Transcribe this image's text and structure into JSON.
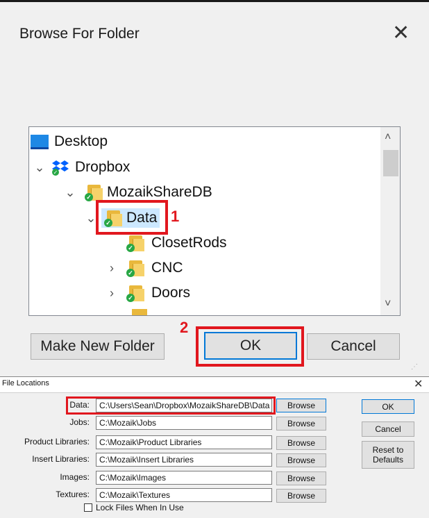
{
  "browse_dialog": {
    "title": "Browse For Folder",
    "close_glyph": "✕",
    "tree": [
      {
        "label": "Desktop",
        "icon": "desktop-icon",
        "chevron": ""
      },
      {
        "label": "Dropbox",
        "icon": "dropbox-icon",
        "chevron": "⌄"
      },
      {
        "label": "MozaikShareDB",
        "icon": "folder-icon",
        "chevron": "⌄"
      },
      {
        "label": "Data",
        "icon": "folder-icon",
        "chevron": "⌄",
        "selected": true
      },
      {
        "label": "ClosetRods",
        "icon": "folder-icon",
        "chevron": ""
      },
      {
        "label": "CNC",
        "icon": "folder-icon",
        "chevron": "›"
      },
      {
        "label": "Doors",
        "icon": "folder-icon",
        "chevron": "›"
      }
    ],
    "buttons": {
      "make_new_folder": "Make New Folder",
      "ok": "OK",
      "cancel": "Cancel"
    },
    "annotations": {
      "step1": "1",
      "step2": "2"
    },
    "colors": {
      "annotation_red": "#e1171e",
      "focus_blue": "#0078d7",
      "selection": "#cce8ff"
    }
  },
  "file_locations": {
    "title": "File Locations",
    "close_glyph": "✕",
    "rows": [
      {
        "label": "Data:",
        "value": "C:\\Users\\Sean\\Dropbox\\MozaikShareDB\\Data",
        "browse": "Browse"
      },
      {
        "label": "Jobs:",
        "value": "C:\\Mozaik\\Jobs",
        "browse": "Browse"
      },
      {
        "label": "Product Libraries:",
        "value": "C:\\Mozaik\\Product Libraries",
        "browse": "Browse"
      },
      {
        "label": "Insert Libraries:",
        "value": "C:\\Mozaik\\Insert Libraries",
        "browse": "Browse"
      },
      {
        "label": "Images:",
        "value": "C:\\Mozaik\\Images",
        "browse": "Browse"
      },
      {
        "label": "Textures:",
        "value": "C:\\Mozaik\\Textures",
        "browse": "Browse"
      }
    ],
    "ok": "OK",
    "cancel": "Cancel",
    "reset": "Reset to Defaults",
    "lock_label": "Lock Files When In Use"
  }
}
